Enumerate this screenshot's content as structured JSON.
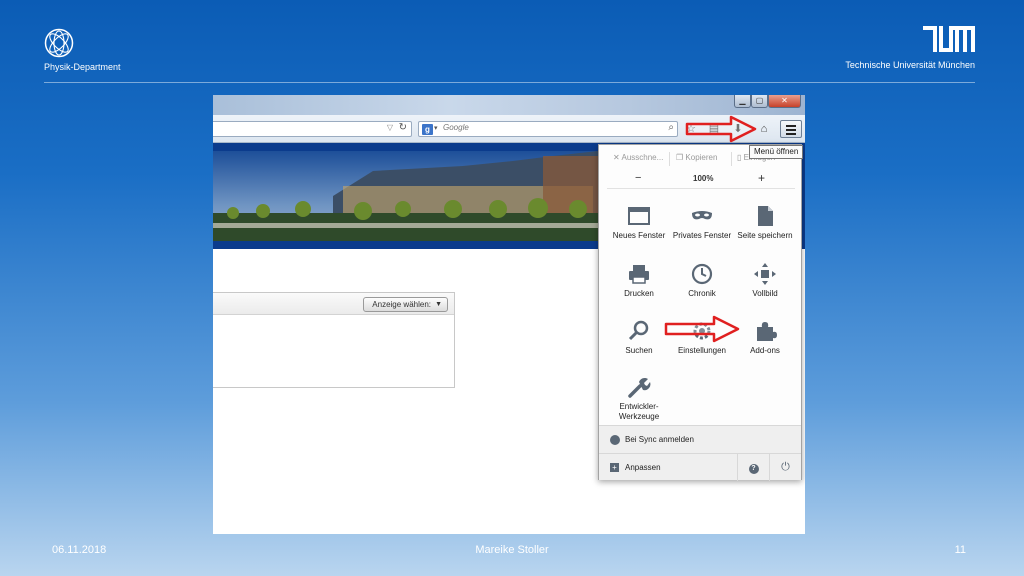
{
  "header": {
    "department": "Physik-Department",
    "university": "Technische Universität München"
  },
  "browser": {
    "search_placeholder": "Google",
    "tooltip": "Menü öffnen"
  },
  "page": {
    "display_select_label": "Anzeige wählen:"
  },
  "menu": {
    "edit": {
      "cut": "Ausschne...",
      "copy": "Kopieren",
      "paste": "Einfügen"
    },
    "zoom": {
      "out": "−",
      "level": "100%",
      "in": "+"
    },
    "items": {
      "new_window": "Neues Fenster",
      "private_window": "Privates Fenster",
      "save_page": "Seite speichern",
      "print": "Drucken",
      "history": "Chronik",
      "fullscreen": "Vollbild",
      "search": "Suchen",
      "settings": "Einstellungen",
      "addons": "Add-ons",
      "developer": "Entwickler-Werkzeuge"
    },
    "sync": "Bei Sync anmelden",
    "customize": "Anpassen",
    "help_symbol": "?",
    "quit_symbol": "⏻"
  },
  "colors": {
    "slide_blue": "#0b5cb5",
    "arrow_red": "#e02020",
    "banner_blue": "#0b3b8c"
  },
  "footer": {
    "date": "06.11.2018",
    "author": "Mareike Stoller",
    "page": "11"
  }
}
